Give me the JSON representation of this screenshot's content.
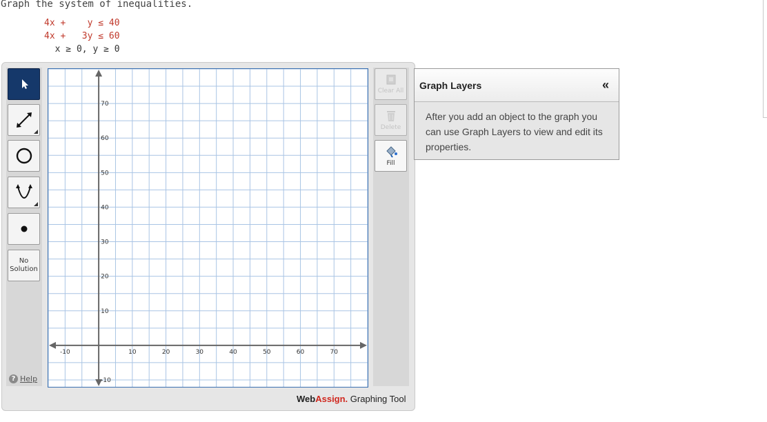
{
  "question": {
    "prompt": "Graph the system of inequalities.",
    "inequalities": [
      {
        "lhs": "4x +    ",
        "rhs": "y ≤ 40"
      },
      {
        "lhs": "4x +   ",
        "rhs": "3y ≤ 60"
      },
      {
        "lhs": "  x ≥ 0, y ≥ 0",
        "rhs": ""
      }
    ]
  },
  "toolbar": {
    "tools": [
      {
        "name": "select-tool",
        "icon": "arrow-pointer-icon"
      },
      {
        "name": "line-tool",
        "icon": "line-segment-icon"
      },
      {
        "name": "circle-tool",
        "icon": "circle-icon"
      },
      {
        "name": "parabola-tool",
        "icon": "parabola-icon"
      },
      {
        "name": "point-tool",
        "icon": "point-icon"
      }
    ],
    "no_solution_line1": "No",
    "no_solution_line2": "Solution",
    "help_label": "Help"
  },
  "graph": {
    "x_range": [
      -15,
      80
    ],
    "y_range": [
      -12,
      80
    ],
    "grid_step": 5,
    "label_step": 10,
    "x_tick_labels": [
      "-10",
      "10",
      "20",
      "30",
      "40",
      "50",
      "60",
      "70"
    ],
    "y_tick_labels": [
      "70",
      "60",
      "50",
      "40",
      "30",
      "20",
      "10",
      "-10"
    ],
    "grid_color": "#a9c4e4",
    "axis_color": "#666666"
  },
  "right_tools": {
    "clear_all": "Clear All",
    "delete": "Delete",
    "fill": "Fill"
  },
  "branding": {
    "web": "Web",
    "assign": "Assign.",
    "suffix": " Graphing Tool"
  },
  "layers": {
    "title": "Graph Layers",
    "collapse_glyph": "«",
    "body": "After you add an object to the graph you can use Graph Layers to view and edit its properties."
  }
}
